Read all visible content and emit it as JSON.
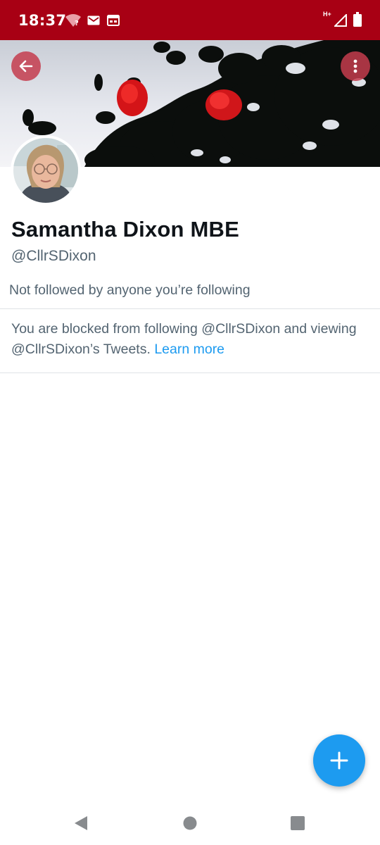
{
  "status_bar": {
    "time": "18:37",
    "network_label": "H+",
    "icons": [
      "wifi-question-icon",
      "gmail-icon",
      "calendar-icon",
      "signal-icon",
      "battery-icon"
    ]
  },
  "profile": {
    "display_name": "Samantha Dixon MBE",
    "handle": "@CllrSDixon",
    "followed_by": "Not followed by anyone you’re following"
  },
  "blocked_notice": {
    "text": "You are blocked from following @CllrSDixon and viewing @CllrSDixon’s Tweets.",
    "link_label": "Learn more"
  },
  "actions": {
    "back_icon": "arrow-left-icon",
    "more_icon": "more-vertical-icon",
    "compose_icon": "plus-icon"
  },
  "nav": {
    "icons": [
      "back-triangle-icon",
      "home-circle-icon",
      "recents-square-icon"
    ]
  },
  "colors": {
    "status_bar": "#a80014",
    "accent": "#1d9bf0",
    "text_primary": "#0f1419",
    "text_secondary": "#536471"
  }
}
